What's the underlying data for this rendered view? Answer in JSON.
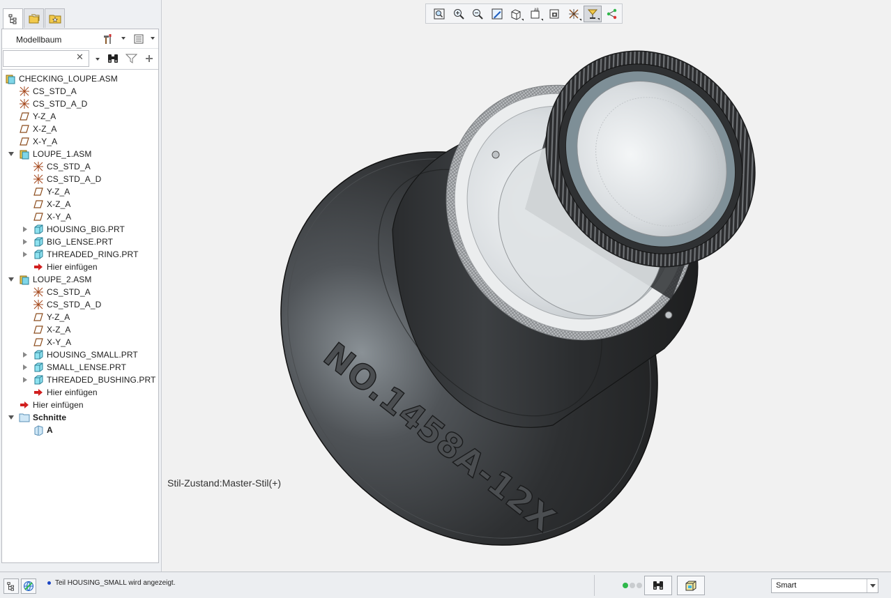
{
  "panel": {
    "title": "Modellbaum",
    "search": {
      "value": "",
      "placeholder": ""
    }
  },
  "tree": [
    {
      "label": "CHECKING_LOUPE.ASM",
      "icon": "assembly-icon",
      "level": 0,
      "toggle": "none"
    },
    {
      "label": "CS_STD_A",
      "icon": "coordinate-system-icon",
      "level": 1,
      "toggle": "none"
    },
    {
      "label": "CS_STD_A_D",
      "icon": "coordinate-system-icon",
      "level": 1,
      "toggle": "none"
    },
    {
      "label": "Y-Z_A",
      "icon": "datum-plane-icon",
      "level": 1,
      "toggle": "none"
    },
    {
      "label": "X-Z_A",
      "icon": "datum-plane-icon",
      "level": 1,
      "toggle": "none"
    },
    {
      "label": "X-Y_A",
      "icon": "datum-plane-icon",
      "level": 1,
      "toggle": "none"
    },
    {
      "label": "LOUPE_1.ASM",
      "icon": "assembly-icon",
      "level": 1,
      "toggle": "expanded"
    },
    {
      "label": "CS_STD_A",
      "icon": "coordinate-system-icon",
      "level": 2,
      "toggle": "none"
    },
    {
      "label": "CS_STD_A_D",
      "icon": "coordinate-system-icon",
      "level": 2,
      "toggle": "none"
    },
    {
      "label": "Y-Z_A",
      "icon": "datum-plane-icon",
      "level": 2,
      "toggle": "none"
    },
    {
      "label": "X-Z_A",
      "icon": "datum-plane-icon",
      "level": 2,
      "toggle": "none"
    },
    {
      "label": "X-Y_A",
      "icon": "datum-plane-icon",
      "level": 2,
      "toggle": "none"
    },
    {
      "label": "HOUSING_BIG.PRT",
      "icon": "part-icon",
      "level": 2,
      "toggle": "collapsed"
    },
    {
      "label": "BIG_LENSE.PRT",
      "icon": "part-icon",
      "level": 2,
      "toggle": "collapsed"
    },
    {
      "label": "THREADED_RING.PRT",
      "icon": "part-icon",
      "level": 2,
      "toggle": "collapsed"
    },
    {
      "label": "Hier einfügen",
      "icon": "insert-here-arrow-icon",
      "level": 2,
      "toggle": "none"
    },
    {
      "label": "LOUPE_2.ASM",
      "icon": "assembly-icon",
      "level": 1,
      "toggle": "expanded"
    },
    {
      "label": "CS_STD_A",
      "icon": "coordinate-system-icon",
      "level": 2,
      "toggle": "none"
    },
    {
      "label": "CS_STD_A_D",
      "icon": "coordinate-system-icon",
      "level": 2,
      "toggle": "none"
    },
    {
      "label": "Y-Z_A",
      "icon": "datum-plane-icon",
      "level": 2,
      "toggle": "none"
    },
    {
      "label": "X-Z_A",
      "icon": "datum-plane-icon",
      "level": 2,
      "toggle": "none"
    },
    {
      "label": "X-Y_A",
      "icon": "datum-plane-icon",
      "level": 2,
      "toggle": "none"
    },
    {
      "label": "HOUSING_SMALL.PRT",
      "icon": "part-icon",
      "level": 2,
      "toggle": "collapsed"
    },
    {
      "label": "SMALL_LENSE.PRT",
      "icon": "part-icon",
      "level": 2,
      "toggle": "collapsed"
    },
    {
      "label": "THREADED_BUSHING.PRT",
      "icon": "part-icon",
      "level": 2,
      "toggle": "collapsed"
    },
    {
      "label": "Hier einfügen",
      "icon": "insert-here-arrow-icon",
      "level": 2,
      "toggle": "none"
    },
    {
      "label": "Hier einfügen",
      "icon": "insert-here-arrow-icon",
      "level": 1,
      "toggle": "none"
    },
    {
      "label": "Schnitte",
      "icon": "sections-folder-icon",
      "level": 0.5,
      "toggle": "expanded"
    },
    {
      "label": "A",
      "icon": "section-icon",
      "level": 2,
      "toggle": "none"
    }
  ],
  "viewport": {
    "style_state": "Stil-Zustand:Master-Stil(+)",
    "engraving": "NO.1458A-12X",
    "toolbar_icons": [
      "refit-icon",
      "zoom-in-icon",
      "zoom-out-icon",
      "repaint-icon",
      "display-style-icon",
      "saved-orientations-icon",
      "view-manager-icon",
      "perspective-icon",
      "datum-display-icon",
      "spin-center-icon",
      "annotation-display-icon"
    ]
  },
  "status": {
    "message": "Teil HOUSING_SMALL wird angezeigt.",
    "filter": "Smart"
  },
  "colors": {
    "accent": "#1a45c4",
    "model_body": "#3a3c3e",
    "status_green": "#2fb84b"
  }
}
